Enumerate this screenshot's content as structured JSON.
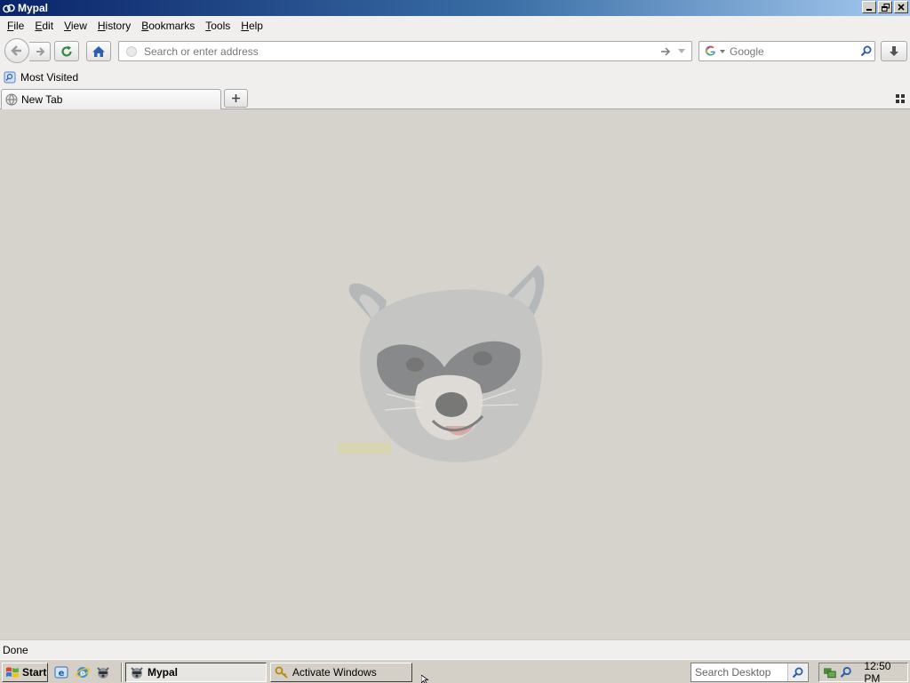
{
  "window": {
    "title": "Mypal"
  },
  "menu": [
    {
      "label": "File",
      "accel": "F",
      "rest": "ile"
    },
    {
      "label": "Edit",
      "accel": "E",
      "rest": "dit"
    },
    {
      "label": "View",
      "accel": "V",
      "rest": "iew"
    },
    {
      "label": "History",
      "accel": "H",
      "rest": "istory"
    },
    {
      "label": "Bookmarks",
      "accel": "B",
      "rest": "ookmarks"
    },
    {
      "label": "Tools",
      "accel": "T",
      "rest": "ools"
    },
    {
      "label": "Help",
      "accel": "H",
      "rest": "elp"
    }
  ],
  "navbar": {
    "url_placeholder": "Search or enter address",
    "search_placeholder": "Google"
  },
  "bookmarks": [
    {
      "label": "Most Visited"
    }
  ],
  "tabs": [
    {
      "label": "New Tab",
      "active": true
    }
  ],
  "status": {
    "text": "Done"
  },
  "taskbar": {
    "start_label": "Start",
    "tasks": [
      {
        "label": "Mypal",
        "active": true
      },
      {
        "label": "Activate Windows",
        "active": false
      }
    ],
    "search_placeholder": "Search Desktop",
    "clock": "12:50 PM"
  },
  "colors": {
    "titlebar_start": "#0a246a",
    "titlebar_end": "#a6caf0",
    "chrome_bg": "#f0efed",
    "content_bg": "#d6d2cc",
    "taskbar_bg": "#d4d0c8"
  }
}
